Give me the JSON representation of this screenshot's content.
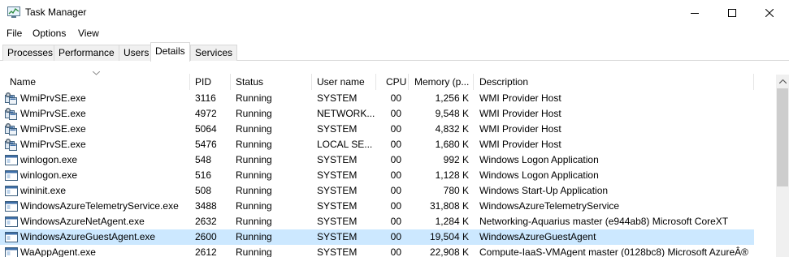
{
  "window": {
    "title": "Task Manager"
  },
  "menu": [
    "File",
    "Options",
    "View"
  ],
  "tabs": [
    "Processes",
    "Performance",
    "Users",
    "Details",
    "Services"
  ],
  "active_tab": "Details",
  "columns": {
    "name": "Name",
    "pid": "PID",
    "status": "Status",
    "user": "User name",
    "cpu": "CPU",
    "memory": "Memory (p...",
    "description": "Description"
  },
  "processes": [
    {
      "icon": "wmi-service-icon",
      "name": "WmiPrvSE.exe",
      "pid": "3116",
      "status": "Running",
      "user": "SYSTEM",
      "cpu": "00",
      "memory": "1,256 K",
      "description": "WMI Provider Host"
    },
    {
      "icon": "wmi-service-icon",
      "name": "WmiPrvSE.exe",
      "pid": "4972",
      "status": "Running",
      "user": "NETWORK...",
      "cpu": "00",
      "memory": "9,548 K",
      "description": "WMI Provider Host"
    },
    {
      "icon": "wmi-service-icon",
      "name": "WmiPrvSE.exe",
      "pid": "5064",
      "status": "Running",
      "user": "SYSTEM",
      "cpu": "00",
      "memory": "4,832 K",
      "description": "WMI Provider Host"
    },
    {
      "icon": "wmi-service-icon",
      "name": "WmiPrvSE.exe",
      "pid": "5476",
      "status": "Running",
      "user": "LOCAL SE...",
      "cpu": "00",
      "memory": "1,680 K",
      "description": "WMI Provider Host"
    },
    {
      "icon": "window-app-icon",
      "name": "winlogon.exe",
      "pid": "548",
      "status": "Running",
      "user": "SYSTEM",
      "cpu": "00",
      "memory": "992 K",
      "description": "Windows Logon Application"
    },
    {
      "icon": "window-app-icon",
      "name": "winlogon.exe",
      "pid": "516",
      "status": "Running",
      "user": "SYSTEM",
      "cpu": "00",
      "memory": "1,128 K",
      "description": "Windows Logon Application"
    },
    {
      "icon": "window-app-icon",
      "name": "wininit.exe",
      "pid": "508",
      "status": "Running",
      "user": "SYSTEM",
      "cpu": "00",
      "memory": "780 K",
      "description": "Windows Start-Up Application"
    },
    {
      "icon": "window-app-icon",
      "name": "WindowsAzureTelemetryService.exe",
      "pid": "3488",
      "status": "Running",
      "user": "SYSTEM",
      "cpu": "00",
      "memory": "31,808 K",
      "description": "WindowsAzureTelemetryService"
    },
    {
      "icon": "window-app-icon",
      "name": "WindowsAzureNetAgent.exe",
      "pid": "2632",
      "status": "Running",
      "user": "SYSTEM",
      "cpu": "00",
      "memory": "1,284 K",
      "description": "Networking-Aquarius master (e944ab8) Microsoft CoreXT"
    },
    {
      "icon": "window-app-icon",
      "name": "WindowsAzureGuestAgent.exe",
      "pid": "2600",
      "status": "Running",
      "user": "SYSTEM",
      "cpu": "00",
      "memory": "19,504 K",
      "description": "WindowsAzureGuestAgent",
      "selected": true
    },
    {
      "icon": "window-app-icon",
      "name": "WaAppAgent.exe",
      "pid": "2612",
      "status": "Running",
      "user": "SYSTEM",
      "cpu": "00",
      "memory": "22,908 K",
      "description": "Compute-IaaS-VMAgent master (0128bc8) Microsoft AzureÂ®"
    }
  ],
  "colors": {
    "selected_row": "#cce8ff",
    "header_separator": "#e5e5e5",
    "tab_border": "#d9d9d9"
  }
}
